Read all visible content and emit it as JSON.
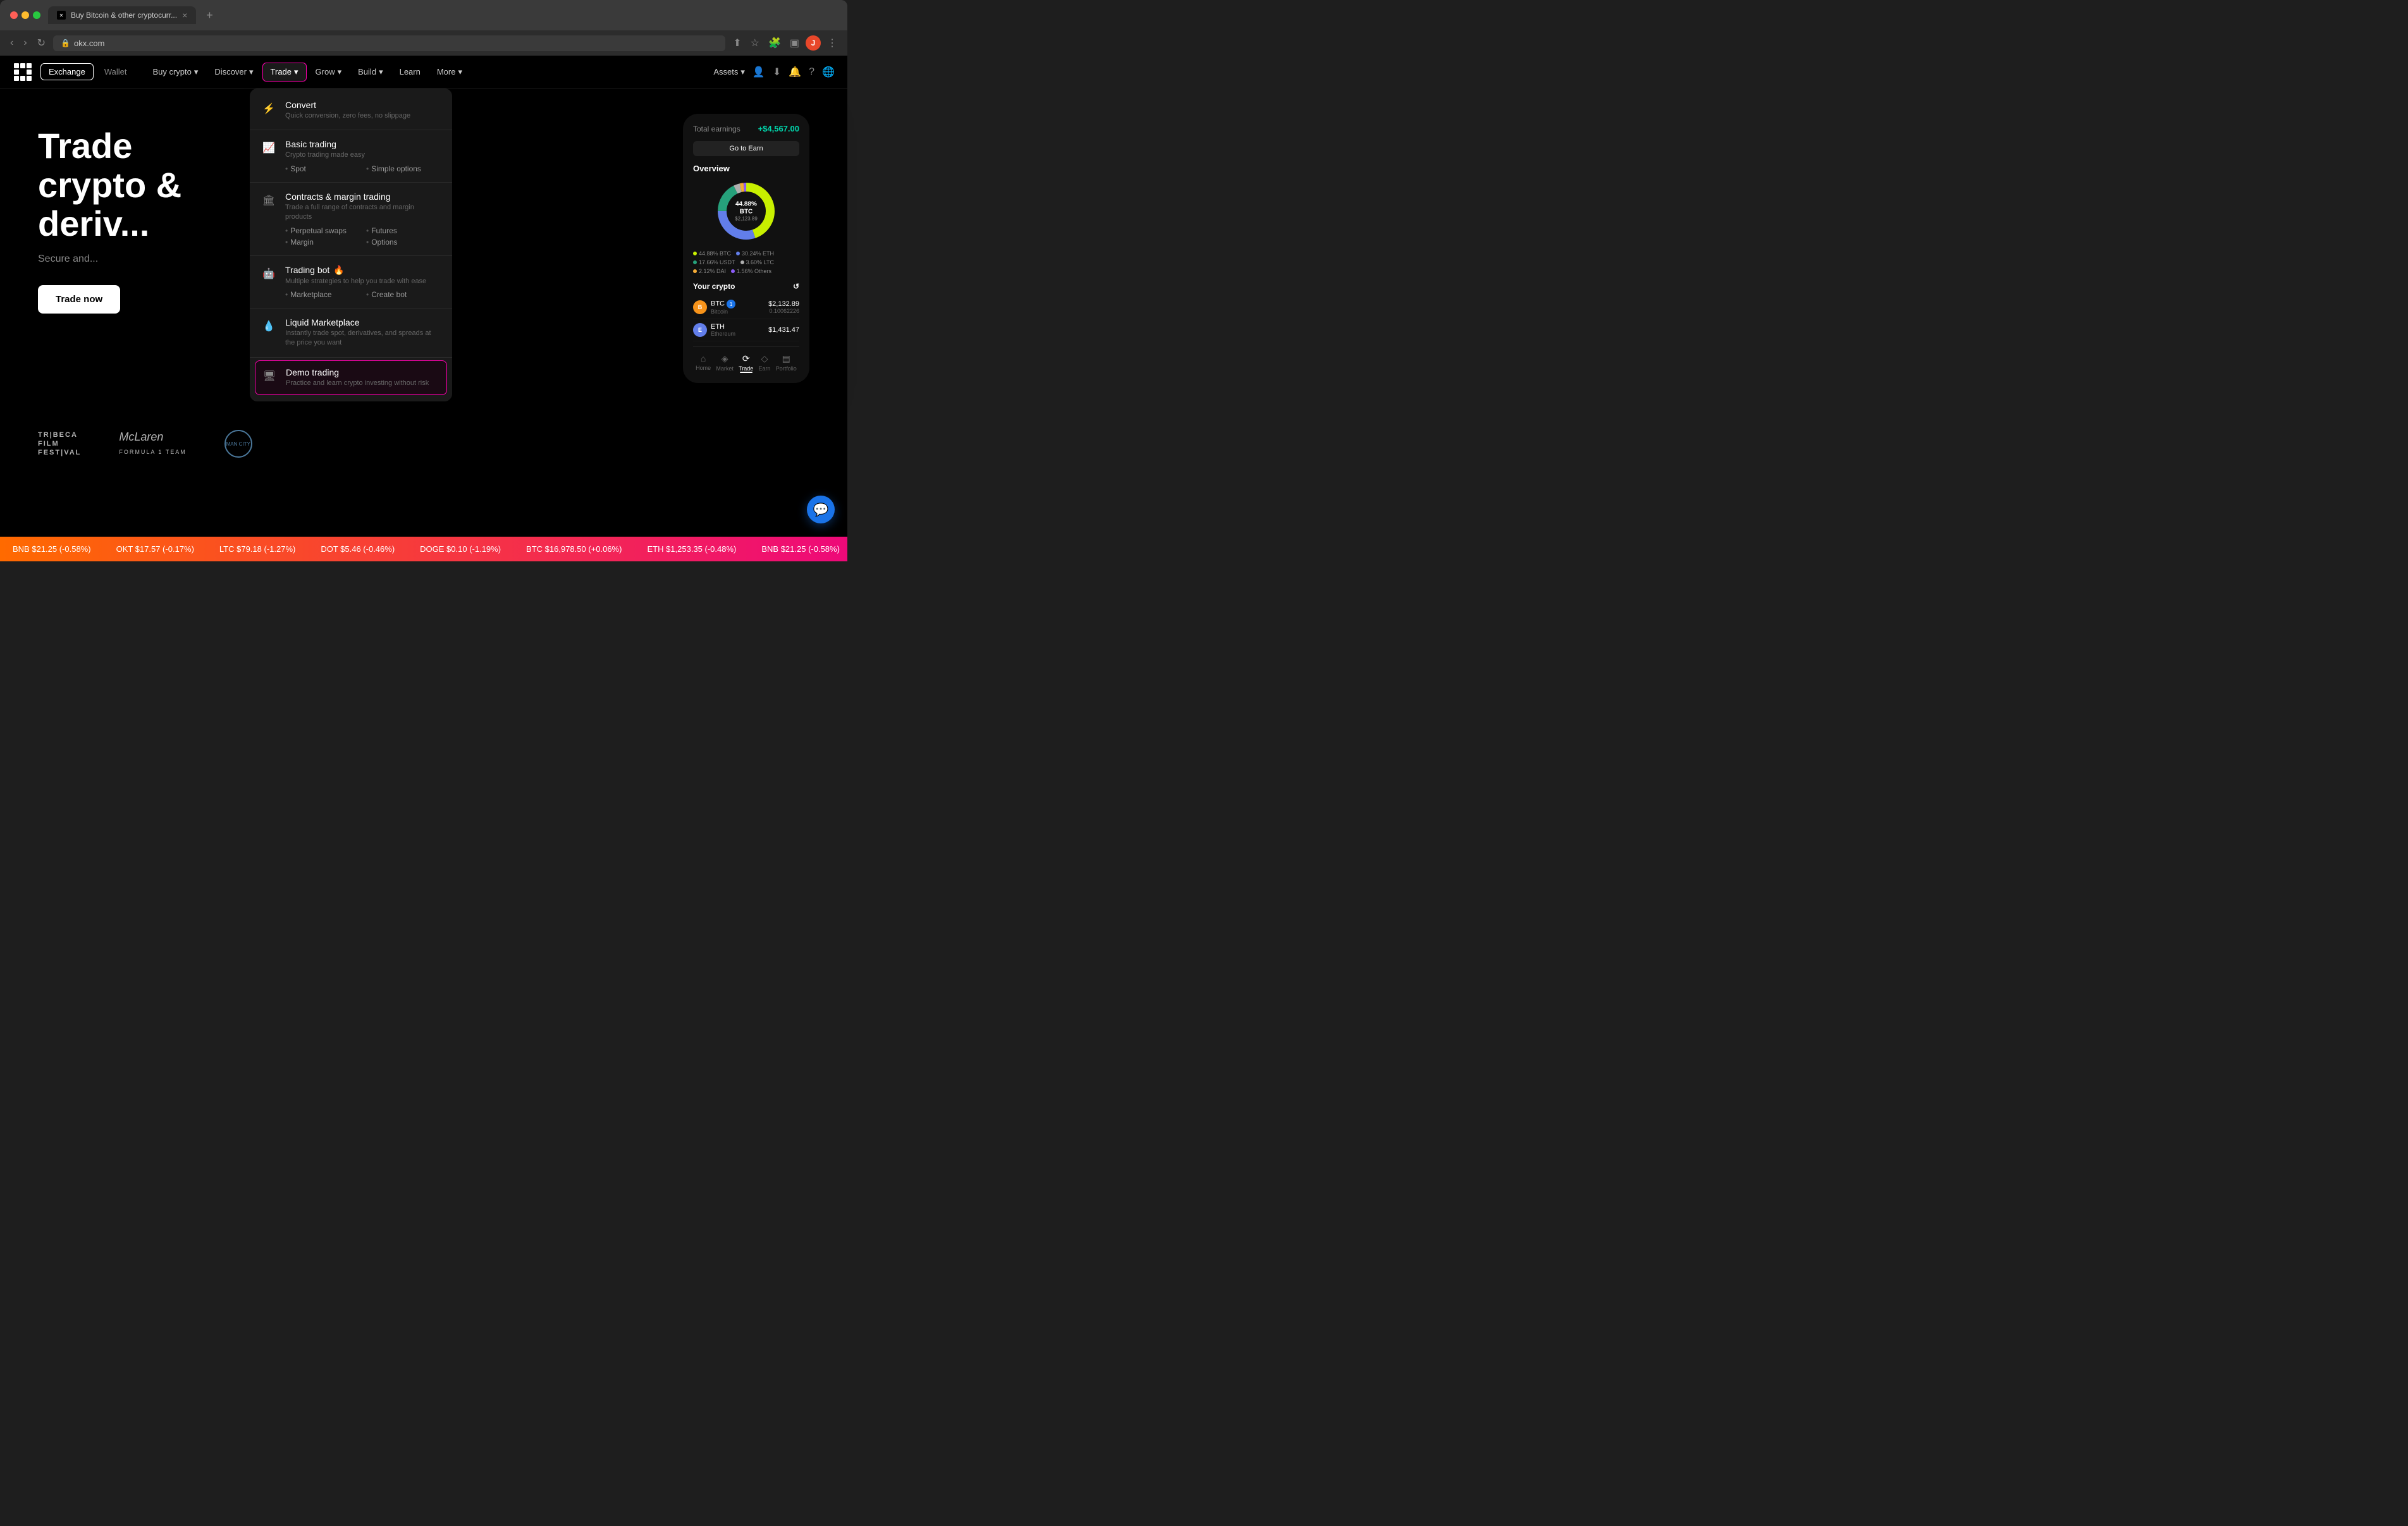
{
  "browser": {
    "tab_title": "Buy Bitcoin & other cryptocurr...",
    "address": "okx.com",
    "new_tab_label": "+",
    "user_initial": "J"
  },
  "nav": {
    "exchange_label": "Exchange",
    "wallet_label": "Wallet",
    "buy_crypto_label": "Buy crypto",
    "discover_label": "Discover",
    "trade_label": "Trade",
    "grow_label": "Grow",
    "build_label": "Build",
    "learn_label": "Learn",
    "more_label": "More",
    "assets_label": "Assets",
    "chevron": "▾"
  },
  "dropdown": {
    "convert": {
      "title": "Convert",
      "desc": "Quick conversion, zero fees, no slippage"
    },
    "basic_trading": {
      "title": "Basic trading",
      "desc": "Crypto trading made easy",
      "sub_items": [
        "Spot",
        "Simple options"
      ]
    },
    "contracts_margin": {
      "title": "Contracts & margin trading",
      "desc": "Trade a full range of contracts and margin products",
      "sub_items": [
        "Perpetual swaps",
        "Futures",
        "Margin",
        "Options"
      ]
    },
    "trading_bot": {
      "title": "Trading bot",
      "emoji": "🔥",
      "desc": "Multiple strategies to help you trade with ease",
      "sub_items": [
        "Marketplace",
        "Create bot"
      ]
    },
    "liquid_marketplace": {
      "title": "Liquid Marketplace",
      "desc": "Instantly trade spot, derivatives, and spreads at the price you want"
    },
    "demo_trading": {
      "title": "Demo trading",
      "desc": "Practice and learn crypto investing without risk"
    }
  },
  "hero": {
    "title_line1": "Trade",
    "title_line2": "crypto &",
    "title_line3": "deriv...",
    "subtitle": "Secure and...",
    "cta_label": "Trade now"
  },
  "app_card": {
    "earnings_label": "Total earnings",
    "earnings_amount": "+$4,567.00",
    "earn_btn_label": "Go to Earn",
    "overview_title": "Overview",
    "donut_pct": "44.88% BTC",
    "donut_amount": "$2,123.89",
    "legend": [
      {
        "label": "44.88% BTC",
        "color": "#c8f000"
      },
      {
        "label": "30.24% ETH",
        "color": "#627eea"
      },
      {
        "label": "17.66% USDT",
        "color": "#26a17b"
      },
      {
        "label": "3.60% LTC",
        "color": "#b0b0b0"
      },
      {
        "label": "2.12% DAI",
        "color": "#f5ac37"
      },
      {
        "label": "1.56% Others",
        "color": "#8b5cf6"
      }
    ],
    "your_crypto_label": "Your crypto",
    "crypto_rows": [
      {
        "symbol": "BTC",
        "name": "Bitcoin",
        "price": "$2,132.89",
        "amount": "0.10062226",
        "icon_bg": "#f7931a",
        "icon_text": "B"
      },
      {
        "symbol": "ETH",
        "name": "Ethereum",
        "price": "$1,431.47",
        "amount": "",
        "icon_bg": "#627eea",
        "icon_text": "E"
      }
    ],
    "bottom_nav": [
      {
        "label": "Home",
        "icon": "⌂",
        "active": false
      },
      {
        "label": "Market",
        "icon": "◈",
        "active": false
      },
      {
        "label": "Trade",
        "icon": "⟳",
        "active": true
      },
      {
        "label": "Earn",
        "icon": "💎",
        "active": false
      },
      {
        "label": "Portfolio",
        "icon": "▤",
        "active": false
      }
    ]
  },
  "partners": [
    {
      "name": "TRIBECA\nFILM\nFESTIVAL"
    },
    {
      "name": "McLaren\nFORMULA 1 TEAM"
    },
    {
      "name": "Manchester City FC"
    }
  ],
  "ticker": {
    "items": [
      "BNB $21.25 (-0.58%)",
      "OKT $17.57 (-0.17%)",
      "LTC $79.18 (-1.27%)",
      "DOT $5.46 (-0.46%)",
      "DOGE $0.10 (-1.19%)",
      "BTC $16,978.50 (+0.06%)",
      "ETH $1,253.35 (-0.48%)",
      "BNB $21.25 (-0.58%)",
      "OKT $17.57 (-0.17%)",
      "LTC $79.18 (-1.27%)",
      "DOT $5.46 (-0.46%)",
      "DOGE $0.10 (-1.19%)",
      "BTC $16,978.50 (+0.06%)",
      "ETH $1,253.35 (-0.48%)"
    ]
  }
}
